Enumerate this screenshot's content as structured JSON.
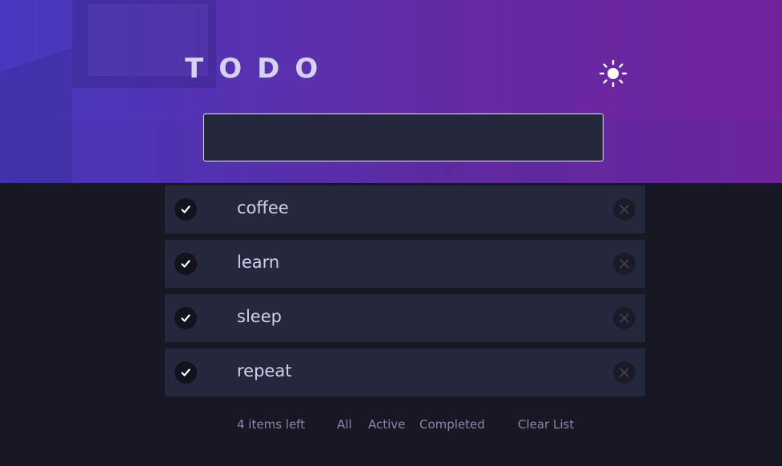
{
  "header": {
    "title": "TODO",
    "theme_toggle_icon": "sun-icon"
  },
  "new_todo": {
    "value": "",
    "placeholder": ""
  },
  "todos": [
    {
      "text": "coffee",
      "completed": true
    },
    {
      "text": "learn",
      "completed": true
    },
    {
      "text": "sleep",
      "completed": true
    },
    {
      "text": "repeat",
      "completed": true
    }
  ],
  "footer": {
    "items_left": "4 items left",
    "filters": [
      "All",
      "Active",
      "Completed"
    ],
    "clear_label": "Clear List"
  },
  "colors": {
    "gradient_start": "#4a3bc7",
    "gradient_end": "#7a22a0",
    "page_bg": "#181824",
    "card_bg": "#25273d",
    "text": "#d3d0ec",
    "muted": "#8a87a8"
  }
}
